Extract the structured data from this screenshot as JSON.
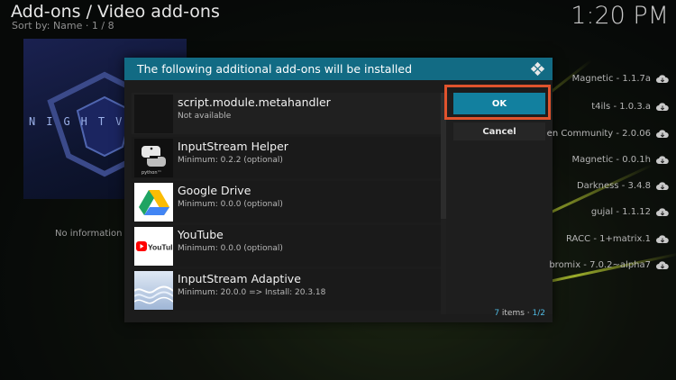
{
  "header": {
    "title": "Add-ons / Video add-ons",
    "sort": "Sort by: Name  ·  1 / 8",
    "clock": "1:20 PM"
  },
  "background": {
    "poster_text": "NIGHTV",
    "no_info": "No information a"
  },
  "right_list": [
    {
      "label": "Magnetic - 1.1.7a",
      "icon": "cloud-download-icon"
    },
    {
      "label": "t4ils - 1.0.3.a",
      "icon": "cloud-download-icon"
    },
    {
      "label": "en Community - 2.0.06",
      "icon": "cloud-download-icon"
    },
    {
      "label": "Magnetic - 0.0.1h",
      "icon": "cloud-download-icon"
    },
    {
      "label": "Darkness - 3.4.8",
      "icon": "cloud-download-icon"
    },
    {
      "label": "gujal - 1.1.12",
      "icon": "cloud-download-icon"
    },
    {
      "label": "RACC - 1+matrix.1",
      "icon": "cloud-download-icon"
    },
    {
      "label": "bromix - 7.0.2~alpha7",
      "icon": "cloud-download-icon"
    }
  ],
  "dialog": {
    "title": "The following additional add-ons will be installed",
    "ok_label": "OK",
    "cancel_label": "Cancel",
    "items_count": "7",
    "items_label": " items · ",
    "page": "1/2",
    "addons": [
      {
        "name": "script.module.metahandler",
        "sub": "Not available",
        "thumb": "blank"
      },
      {
        "name": "InputStream Helper",
        "sub": "Minimum: 0.2.2 (optional)",
        "thumb": "python-logo"
      },
      {
        "name": "Google Drive",
        "sub": "Minimum: 0.0.0 (optional)",
        "thumb": "google-drive-logo"
      },
      {
        "name": "YouTube",
        "sub": "Minimum: 0.0.0 (optional)",
        "thumb": "youtube-logo"
      },
      {
        "name": "InputStream Adaptive",
        "sub": "Minimum: 20.0.0 => Install: 20.3.18",
        "thumb": "wave-image"
      }
    ]
  },
  "colors": {
    "header_bar": "#126b84",
    "ok_button": "#12809f",
    "highlight": "#e0532d"
  }
}
